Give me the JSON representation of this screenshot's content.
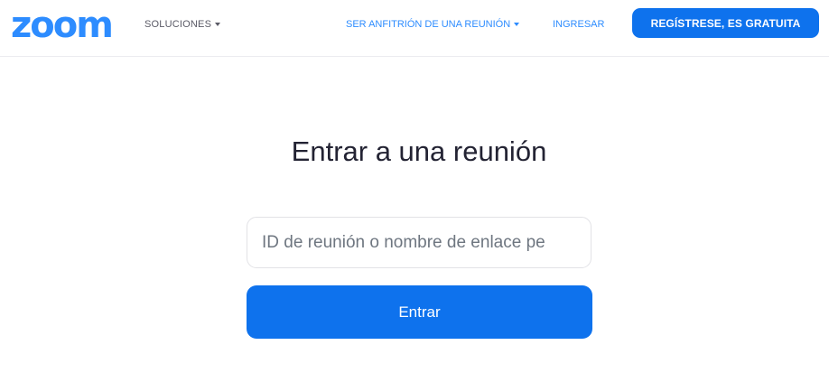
{
  "header": {
    "logo_text": "zoom",
    "nav": {
      "solutions_label": "SOLUCIONES",
      "host_label": "SER ANFITRIÓN DE UNA REUNIÓN",
      "login_label": "INGRESAR"
    },
    "signup_label": "REGÍSTRESE, ES GRATUITA"
  },
  "main": {
    "title": "Entrar a una reunión",
    "meeting_input": {
      "value": "",
      "placeholder": "ID de reunión o nombre de enlace pe"
    },
    "join_label": "Entrar"
  },
  "colors": {
    "brand": "#2d8cff",
    "button": "#0e72ed",
    "text": "#232333"
  },
  "icons": {
    "dropdown": "caret-down-icon"
  }
}
